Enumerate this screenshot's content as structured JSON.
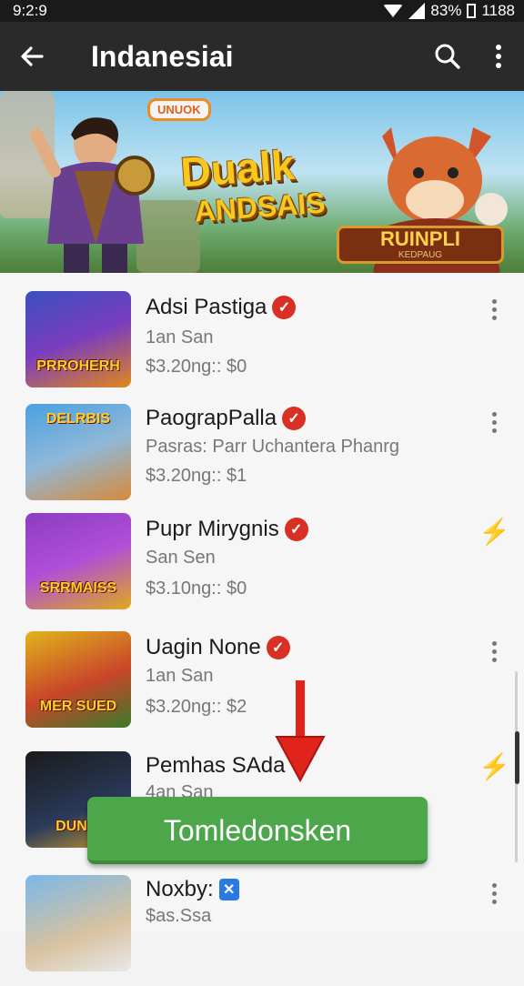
{
  "status": {
    "time": "9:2:9",
    "battery": "83%",
    "extra": "1188"
  },
  "appbar": {
    "title": "Indanesiai",
    "back_icon": "arrow-left-icon",
    "search_icon": "search-icon",
    "menu_icon": "more-vert-icon"
  },
  "banner": {
    "badge": "UNUOK",
    "title_line1": "Dualk",
    "title_line2": "ANDSAIS",
    "tag_main": "RUINPLI",
    "tag_sub": "KEDPAUG"
  },
  "items": [
    {
      "title": "Adsi Pastiga",
      "subtitle": "1an San",
      "price": "$3.20ng:: $0",
      "thumb_label": "PRROHERH",
      "thumb_top": "",
      "action": "more"
    },
    {
      "title": "PaograpPalla",
      "subtitle": "Pasras: Parr Uchantera Phanrg",
      "price": "$3.20ng:: $1",
      "thumb_label": "",
      "thumb_top": "DELRBIS",
      "action": "more"
    },
    {
      "title": "Pupr Mirygnis",
      "subtitle": "San Sen",
      "price": "$3.10ng:: $0",
      "thumb_label": "SRRMAISS",
      "thumb_top": "",
      "action": "bolt"
    },
    {
      "title": "Uagin None",
      "subtitle": "1an San",
      "price": "$3.20ng:: $2",
      "thumb_label": "MER SUED",
      "thumb_top": "",
      "action": "more"
    },
    {
      "title": "Pemhas SAda",
      "subtitle": "4an San",
      "price": "",
      "thumb_label": "DUNIS",
      "thumb_top": "",
      "action": "bolt"
    },
    {
      "title": "Noxby:",
      "subtitle": "$as.Ssa",
      "price": "",
      "thumb_label": "",
      "thumb_top": "",
      "action": "more"
    }
  ],
  "cta": {
    "label": "Tomledonsken"
  },
  "colors": {
    "appbar": "#2a2a2a",
    "cta": "#4ca64a",
    "badge_red": "#d93025",
    "arrow_red": "#e0241c"
  }
}
